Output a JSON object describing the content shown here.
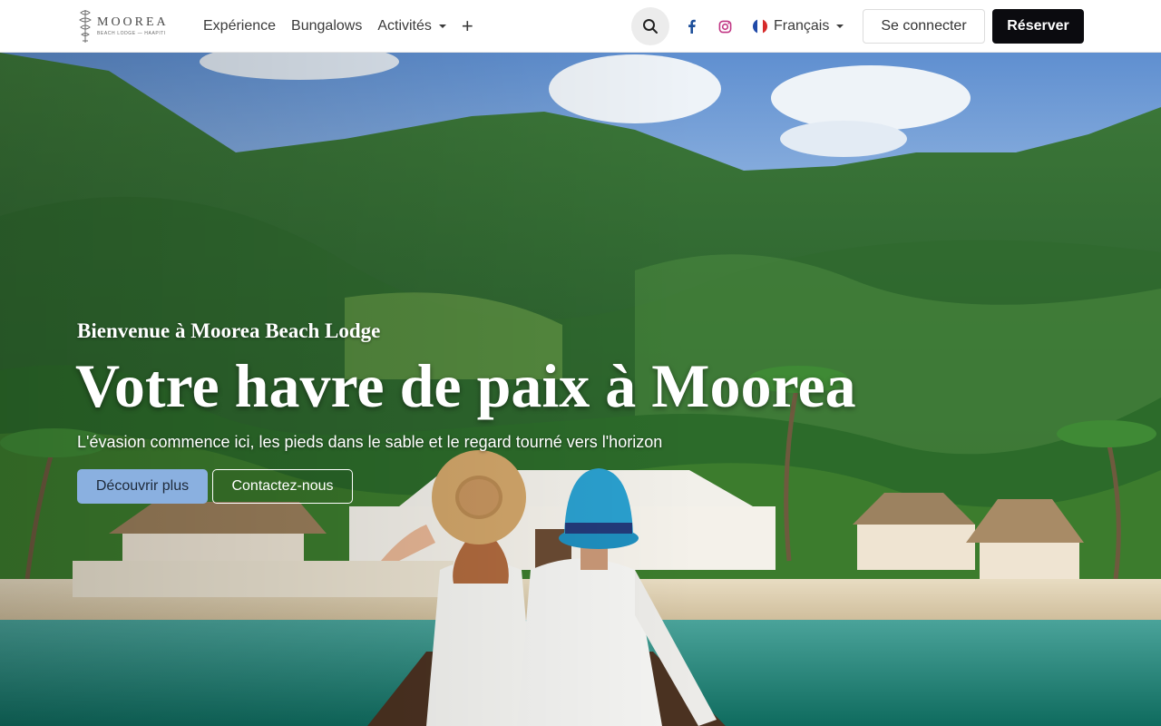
{
  "brand": {
    "name": "MOOREA",
    "tagline": "BEACH LODGE — HAAPITI",
    "logo_icon": "tiki-logo-icon"
  },
  "nav": {
    "links": [
      {
        "label": "Expérience"
      },
      {
        "label": "Bungalows"
      },
      {
        "label": "Activités",
        "has_dropdown": true
      }
    ],
    "more_label": "+",
    "search_icon": "search-icon",
    "social": [
      "facebook-icon",
      "instagram-icon"
    ],
    "language": {
      "label": "Français",
      "flag": "france-flag-icon"
    },
    "login_label": "Se connecter",
    "book_label": "Réserver"
  },
  "hero": {
    "kicker": "Bienvenue à Moorea Beach Lodge",
    "title": "Votre havre de paix à Moorea",
    "subtitle": "L'évasion commence ici, les pieds dans le sable et le regard tourné vers l'horizon",
    "primary_cta": "Découvrir plus",
    "secondary_cta": "Contactez-nous",
    "image": "hero-beach-couple-image"
  },
  "colors": {
    "book_button": "#0b0b0f",
    "discover_button": "#8ab0e0",
    "ig_pink": "#c13584",
    "fb_blue": "#1877f2"
  }
}
